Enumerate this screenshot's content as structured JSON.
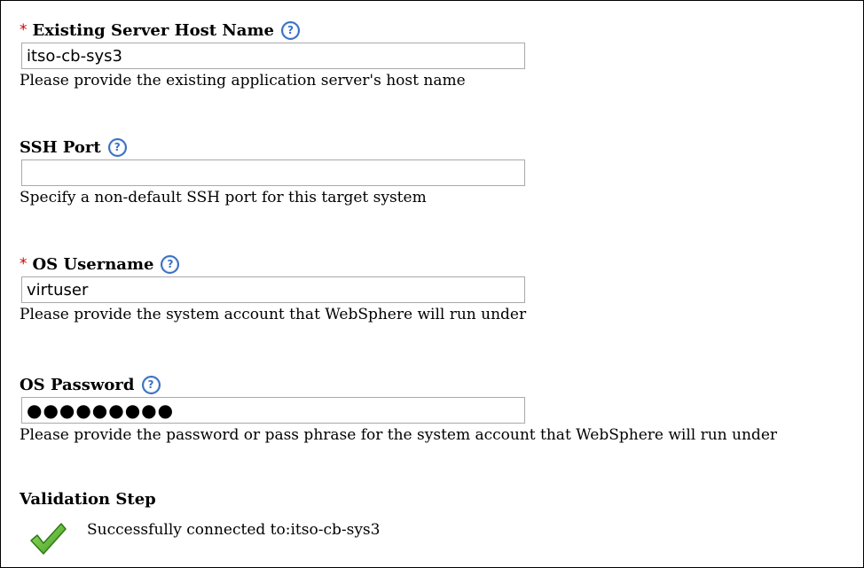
{
  "fields": [
    {
      "required": true,
      "required_mark": "*",
      "label": "Existing Server Host Name",
      "value": "itso-cb-sys3",
      "hint": "Please provide the existing application server's host name",
      "help_icon": "help-icon"
    },
    {
      "required": false,
      "label": "SSH Port",
      "value": "",
      "hint": "Specify a non-default SSH port for this target system",
      "help_icon": "help-icon"
    },
    {
      "required": true,
      "required_mark": "*",
      "label": "OS Username",
      "value": "virtuser",
      "hint": "Please provide the system account that WebSphere will run under",
      "help_icon": "help-icon"
    },
    {
      "required": false,
      "label": "OS Password",
      "value": "●●●●●●●●●",
      "hint": "Please provide the password or pass phrase for the system account that WebSphere will run under",
      "help_icon": "help-icon"
    }
  ],
  "validation": {
    "title": "Validation Step",
    "status_text": "Successfully connected to:itso-cb-sys3",
    "status_icon": "checkmark-icon"
  },
  "colors": {
    "required": "#cc0000",
    "help_icon": "#3a6fc2",
    "check": "#5bb030"
  }
}
